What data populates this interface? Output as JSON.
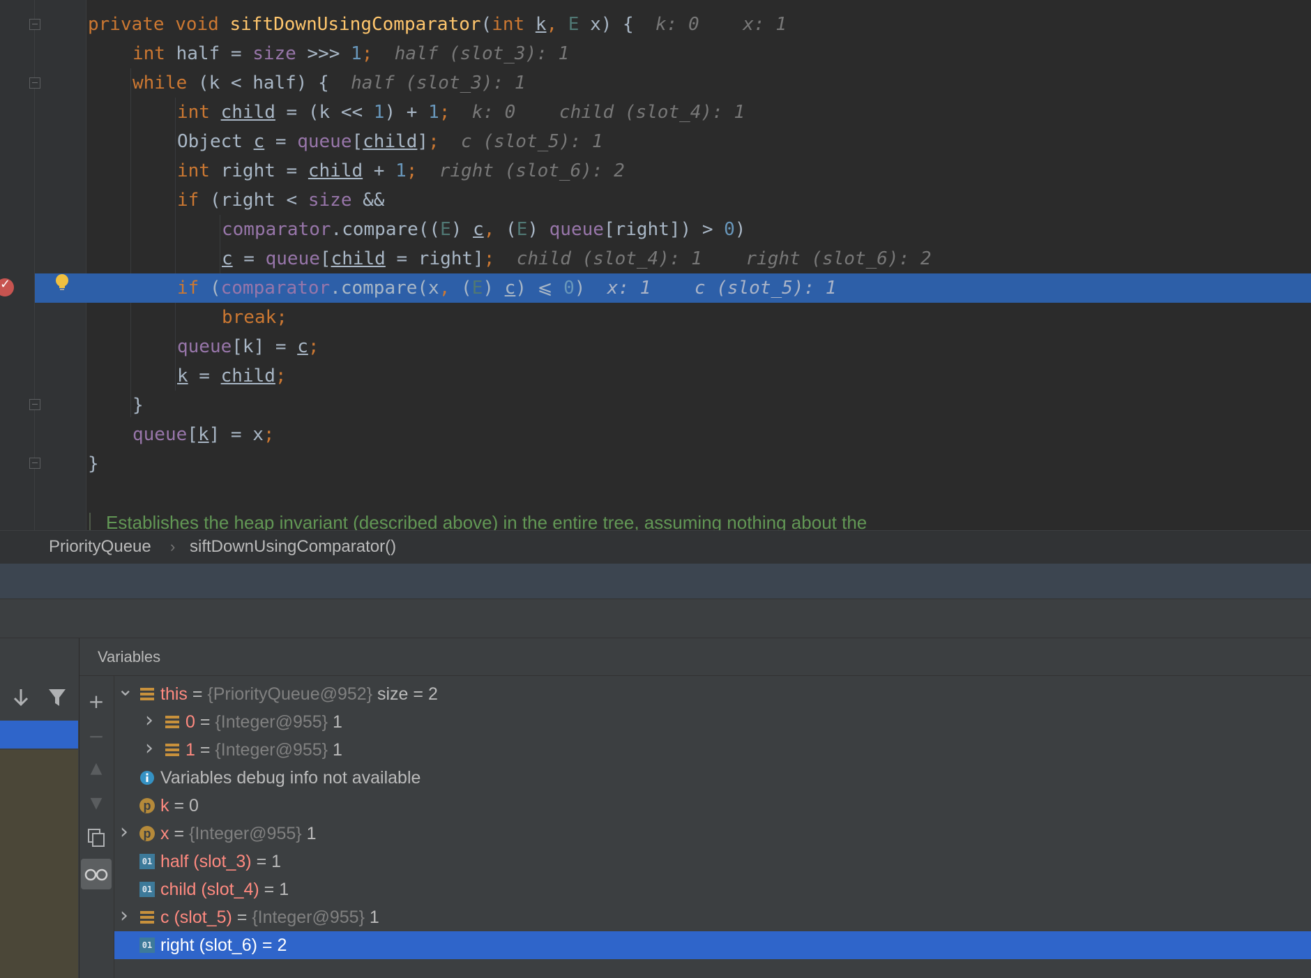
{
  "editor": {
    "code_lines": [
      {
        "tokens": [
          {
            "t": "private void ",
            "c": "kw"
          },
          {
            "t": "siftDownUsingComparator",
            "c": "fn"
          },
          {
            "t": "(",
            "c": ""
          },
          {
            "t": "int ",
            "c": "kw"
          },
          {
            "t": "k",
            "c": "ul"
          },
          {
            "t": ", ",
            "c": "kw"
          },
          {
            "t": "E ",
            "c": "tp"
          },
          {
            "t": "x) {",
            "c": ""
          },
          {
            "t": "  k: 0    x: 1",
            "c": "hint"
          }
        ]
      },
      {
        "tokens": [
          {
            "t": "int ",
            "c": "kw"
          },
          {
            "t": "half = ",
            "c": ""
          },
          {
            "t": "size",
            "c": "fld"
          },
          {
            "t": " >>> ",
            "c": ""
          },
          {
            "t": "1",
            "c": "num"
          },
          {
            "t": ";",
            "c": "kw"
          },
          {
            "t": "  half (slot_3): 1",
            "c": "hint"
          }
        ]
      },
      {
        "tokens": [
          {
            "t": "while ",
            "c": "kw"
          },
          {
            "t": "(k < half) {",
            "c": ""
          },
          {
            "t": "  half (slot_3): 1",
            "c": "hint"
          }
        ]
      },
      {
        "tokens": [
          {
            "t": "int ",
            "c": "kw"
          },
          {
            "t": "child",
            "c": "ul"
          },
          {
            "t": " = (k << ",
            "c": ""
          },
          {
            "t": "1",
            "c": "num"
          },
          {
            "t": ") + ",
            "c": ""
          },
          {
            "t": "1",
            "c": "num"
          },
          {
            "t": ";",
            "c": "kw"
          },
          {
            "t": "  k: 0    child (slot_4): 1",
            "c": "hint"
          }
        ]
      },
      {
        "tokens": [
          {
            "t": "Object ",
            "c": ""
          },
          {
            "t": "c",
            "c": "ul"
          },
          {
            "t": " = ",
            "c": ""
          },
          {
            "t": "queue",
            "c": "fld"
          },
          {
            "t": "[",
            "c": ""
          },
          {
            "t": "child",
            "c": "ul"
          },
          {
            "t": "]",
            "c": ""
          },
          {
            "t": ";",
            "c": "kw"
          },
          {
            "t": "  c (slot_5): 1",
            "c": "hint"
          }
        ]
      },
      {
        "tokens": [
          {
            "t": "int ",
            "c": "kw"
          },
          {
            "t": "right = ",
            "c": ""
          },
          {
            "t": "child",
            "c": "ul"
          },
          {
            "t": " + ",
            "c": ""
          },
          {
            "t": "1",
            "c": "num"
          },
          {
            "t": ";",
            "c": "kw"
          },
          {
            "t": "  right (slot_6): 2",
            "c": "hint"
          }
        ]
      },
      {
        "tokens": [
          {
            "t": "if ",
            "c": "kw"
          },
          {
            "t": "(right < ",
            "c": ""
          },
          {
            "t": "size",
            "c": "fld"
          },
          {
            "t": " &&",
            "c": ""
          }
        ]
      },
      {
        "tokens": [
          {
            "t": "comparator",
            "c": "fld"
          },
          {
            "t": ".compare((",
            "c": ""
          },
          {
            "t": "E",
            "c": "tp"
          },
          {
            "t": ") ",
            "c": ""
          },
          {
            "t": "c",
            "c": "ul"
          },
          {
            "t": ", ",
            "c": "kw"
          },
          {
            "t": "(",
            "c": ""
          },
          {
            "t": "E",
            "c": "tp"
          },
          {
            "t": ") ",
            "c": ""
          },
          {
            "t": "queue",
            "c": "fld"
          },
          {
            "t": "[right]) > ",
            "c": ""
          },
          {
            "t": "0",
            "c": "num"
          },
          {
            "t": ")",
            "c": ""
          }
        ]
      },
      {
        "tokens": [
          {
            "t": "c",
            "c": "ul"
          },
          {
            "t": " = ",
            "c": ""
          },
          {
            "t": "queue",
            "c": "fld"
          },
          {
            "t": "[",
            "c": ""
          },
          {
            "t": "child",
            "c": "ul"
          },
          {
            "t": " = right]",
            "c": ""
          },
          {
            "t": ";",
            "c": "kw"
          },
          {
            "t": "  child (slot_4): 1    right (slot_6): 2",
            "c": "hint"
          }
        ]
      },
      {
        "tokens": [
          {
            "t": "if ",
            "c": "kw"
          },
          {
            "t": "(",
            "c": ""
          },
          {
            "t": "comparator",
            "c": "fld"
          },
          {
            "t": ".compare(x",
            "c": ""
          },
          {
            "t": ", ",
            "c": "kw"
          },
          {
            "t": "(",
            "c": ""
          },
          {
            "t": "E",
            "c": "tp"
          },
          {
            "t": ") ",
            "c": ""
          },
          {
            "t": "c",
            "c": "ul"
          },
          {
            "t": ") ⩽ ",
            "c": ""
          },
          {
            "t": "0",
            "c": "num"
          },
          {
            "t": ")",
            "c": ""
          },
          {
            "t": "  x: 1    c (slot_5): 1",
            "c": "hint"
          }
        ]
      },
      {
        "tokens": [
          {
            "t": "break;",
            "c": "kw"
          }
        ]
      },
      {
        "tokens": [
          {
            "t": "queue",
            "c": "fld"
          },
          {
            "t": "[k] = ",
            "c": ""
          },
          {
            "t": "c",
            "c": "ul"
          },
          {
            "t": ";",
            "c": "kw"
          }
        ]
      },
      {
        "tokens": [
          {
            "t": "k",
            "c": "ul"
          },
          {
            "t": " = ",
            "c": ""
          },
          {
            "t": "child",
            "c": "ul"
          },
          {
            "t": ";",
            "c": "kw"
          }
        ]
      },
      {
        "tokens": [
          {
            "t": "}",
            "c": ""
          }
        ]
      },
      {
        "tokens": [
          {
            "t": "queue",
            "c": "fld"
          },
          {
            "t": "[",
            "c": ""
          },
          {
            "t": "k",
            "c": "ul"
          },
          {
            "t": "] = x",
            "c": ""
          },
          {
            "t": ";",
            "c": "kw"
          }
        ]
      },
      {
        "tokens": [
          {
            "t": "}",
            "c": ""
          }
        ]
      }
    ],
    "comment_text": "Establishes the heap invariant (described above) in the entire tree, assuming nothing about the"
  },
  "breadcrumb": {
    "items": [
      "PriorityQueue",
      "siftDownUsingComparator()"
    ],
    "separator": "›"
  },
  "debugger": {
    "panel_title": "Variables",
    "variables": [
      {
        "indent": 0,
        "expand": "open",
        "icon": "field-icon",
        "name": "this",
        "type": "{PriorityQueue@952}",
        "value": "size = 2"
      },
      {
        "indent": 1,
        "expand": "closed",
        "icon": "field-icon",
        "name": "0",
        "type": "{Integer@955}",
        "value": "1"
      },
      {
        "indent": 1,
        "expand": "closed",
        "icon": "field-icon",
        "name": "1",
        "type": "{Integer@955}",
        "value": "1"
      },
      {
        "indent": 0,
        "expand": "none",
        "icon": "info-icon",
        "name": "",
        "type": "",
        "value": "Variables debug info not available"
      },
      {
        "indent": 0,
        "expand": "none",
        "icon": "parameter-icon",
        "name": "k",
        "type": "",
        "value": "0"
      },
      {
        "indent": 0,
        "expand": "closed",
        "icon": "parameter-icon",
        "name": "x",
        "type": "{Integer@955}",
        "value": "1"
      },
      {
        "indent": 0,
        "expand": "none",
        "icon": "primitive-icon",
        "name": "half (slot_3)",
        "type": "",
        "value": "1"
      },
      {
        "indent": 0,
        "expand": "none",
        "icon": "primitive-icon",
        "name": "child (slot_4)",
        "type": "",
        "value": "1"
      },
      {
        "indent": 0,
        "expand": "closed",
        "icon": "field-icon",
        "name": "c (slot_5)",
        "type": "{Integer@955}",
        "value": "1"
      },
      {
        "indent": 0,
        "expand": "none",
        "icon": "primitive-icon",
        "name": "right (slot_6)",
        "type": "",
        "value": "2",
        "selected": true
      }
    ],
    "icon_glyphs": {
      "parameter": "p",
      "primitive": "01",
      "info": "i"
    },
    "colors": {
      "selection": "#2f65ca",
      "highlight_line": "#2d5fa8",
      "var_name": "#ff8a80",
      "keyword": "#cc7832",
      "field": "#9876aa",
      "number": "#6897bb"
    }
  }
}
